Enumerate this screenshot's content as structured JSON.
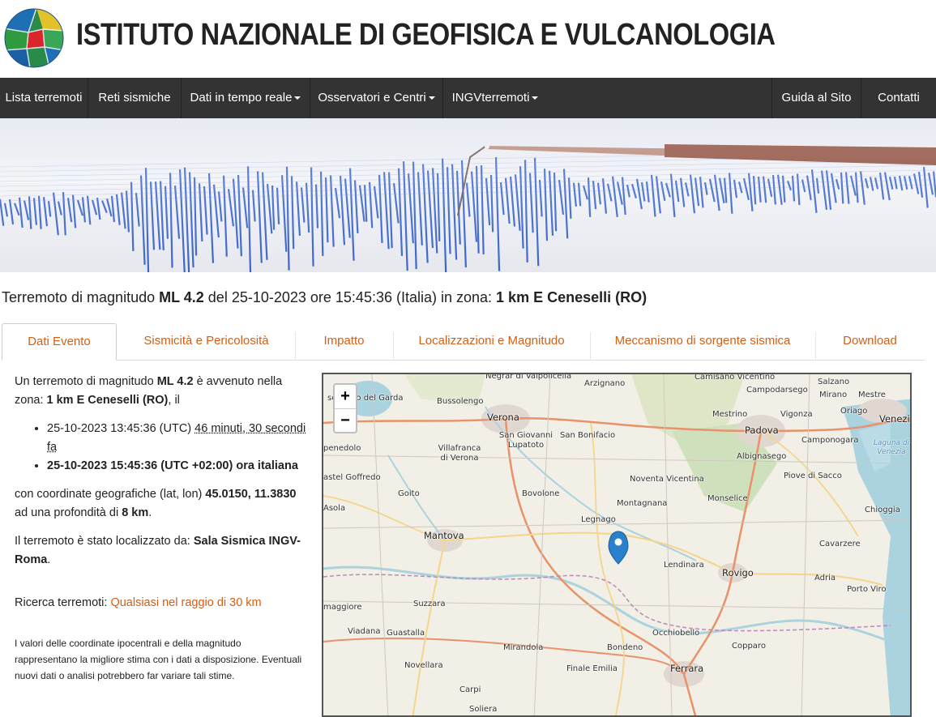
{
  "site": {
    "title": "ISTITUTO NAZIONALE DI GEOFISICA E VULCANOLOGIA"
  },
  "nav": {
    "left": [
      {
        "label": "Lista terremoti",
        "dropdown": false
      },
      {
        "label": "Reti sismiche",
        "dropdown": false
      },
      {
        "label": "Dati in tempo reale",
        "dropdown": true
      },
      {
        "label": "Osservatori e Centri",
        "dropdown": true
      },
      {
        "label": "INGVterremoti",
        "dropdown": true
      }
    ],
    "right": [
      {
        "label": "Guida al Sito"
      },
      {
        "label": "Contatti"
      }
    ]
  },
  "headline": {
    "prefix": "Terremoto di magnitudo ",
    "magnitude": "ML 4.2",
    "mid": " del 25-10-2023 ore 15:45:36 (Italia) in zona: ",
    "zone": "1 km E Ceneselli (RO)"
  },
  "tabs": [
    {
      "label": "Dati Evento",
      "active": true
    },
    {
      "label": "Sismicità e Pericolosità",
      "active": false
    },
    {
      "label": "Impatto",
      "active": false
    },
    {
      "label": "Localizzazioni e Magnitudo",
      "active": false
    },
    {
      "label": "Meccanismo di sorgente sismica",
      "active": false
    },
    {
      "label": "Download",
      "active": false
    }
  ],
  "event": {
    "intro_a": "Un terremoto di magnitudo ",
    "magnitude": "ML 4.2",
    "intro_b": " è avvenuto nella zona: ",
    "zone": "1 km E Ceneselli (RO)",
    "intro_c": ", il",
    "utc_time": "25-10-2023 13:45:36 (UTC) ",
    "ago": "46 minuti, 30 secondi fa",
    "local_time": "25-10-2023 15:45:36 (UTC +02:00) ora italiana",
    "coord_prefix": "con coordinate geografiche (lat, lon) ",
    "coords": "45.0150, 11.3830",
    "depth_prefix": " ad una profondità di ",
    "depth": "8 km",
    "depth_suffix": ".",
    "located_prefix": "Il terremoto è stato localizzato da: ",
    "located_by": "Sala Sismica INGV-Roma",
    "located_suffix": ".",
    "search_label": "Ricerca terremoti: ",
    "search_link": "Qualsiasi nel raggio di 30 km",
    "disclaimer": "I valori delle coordinate ipocentrali e della magnitudo rappresentano la migliore stima con i dati a disposizione. Eventuali nuovi dati o analisi potrebbero far variare tali stime."
  },
  "map": {
    "zoom_in": "+",
    "zoom_out": "−",
    "places": [
      {
        "name": "Negrar di Valpolicella",
        "size": "small"
      },
      {
        "name": "Arzignano",
        "size": "small"
      },
      {
        "name": "Camisano Vicentino",
        "size": "small"
      },
      {
        "name": "Campodarsego",
        "size": "small"
      },
      {
        "name": "Salzano",
        "size": "small"
      },
      {
        "name": "Mirano",
        "size": "small"
      },
      {
        "name": "Mestre",
        "size": "small"
      },
      {
        "name": "senzano del Garda",
        "size": "small"
      },
      {
        "name": "Bussolengo",
        "size": "small"
      },
      {
        "name": "Verona",
        "size": "big"
      },
      {
        "name": "Mestrino",
        "size": "small"
      },
      {
        "name": "Vigonza",
        "size": "small"
      },
      {
        "name": "Oriago",
        "size": "small"
      },
      {
        "name": "Venezi",
        "size": "big"
      },
      {
        "name": "San Giovanni Lupatoto",
        "size": "small"
      },
      {
        "name": "San Bonifacio",
        "size": "small"
      },
      {
        "name": "Padova",
        "size": "big"
      },
      {
        "name": "Camponogara",
        "size": "small"
      },
      {
        "name": "Laguna di Venezia",
        "size": "water"
      },
      {
        "name": "penedolo",
        "size": "small"
      },
      {
        "name": "Villafranca di Verona",
        "size": "small"
      },
      {
        "name": "Albignasego",
        "size": "small"
      },
      {
        "name": "astel Goffredo",
        "size": "small"
      },
      {
        "name": "Noventa Vicentina",
        "size": "small"
      },
      {
        "name": "Piove di Sacco",
        "size": "small"
      },
      {
        "name": "Goito",
        "size": "small"
      },
      {
        "name": "Bovolone",
        "size": "small"
      },
      {
        "name": "Montagnana",
        "size": "small"
      },
      {
        "name": "Monselice",
        "size": "small"
      },
      {
        "name": "Chioggia",
        "size": "small"
      },
      {
        "name": "Asola",
        "size": "small"
      },
      {
        "name": "Legnago",
        "size": "small"
      },
      {
        "name": "Mantova",
        "size": "big"
      },
      {
        "name": "Cavarzere",
        "size": "small"
      },
      {
        "name": "Lendinara",
        "size": "small"
      },
      {
        "name": "Rovigo",
        "size": "big"
      },
      {
        "name": "Adria",
        "size": "small"
      },
      {
        "name": "Porto Viro",
        "size": "small"
      },
      {
        "name": "maggiore",
        "size": "small"
      },
      {
        "name": "Suzzara",
        "size": "small"
      },
      {
        "name": "Viadana",
        "size": "small"
      },
      {
        "name": "Guastalla",
        "size": "small"
      },
      {
        "name": "Occhiobello",
        "size": "small"
      },
      {
        "name": "Copparo",
        "size": "small"
      },
      {
        "name": "Mirandola",
        "size": "small"
      },
      {
        "name": "Bondeno",
        "size": "small"
      },
      {
        "name": "Novellara",
        "size": "small"
      },
      {
        "name": "Finale Emilia",
        "size": "small"
      },
      {
        "name": "Ferrara",
        "size": "big"
      },
      {
        "name": "Carpi",
        "size": "small"
      },
      {
        "name": "Soliera",
        "size": "small"
      }
    ]
  }
}
